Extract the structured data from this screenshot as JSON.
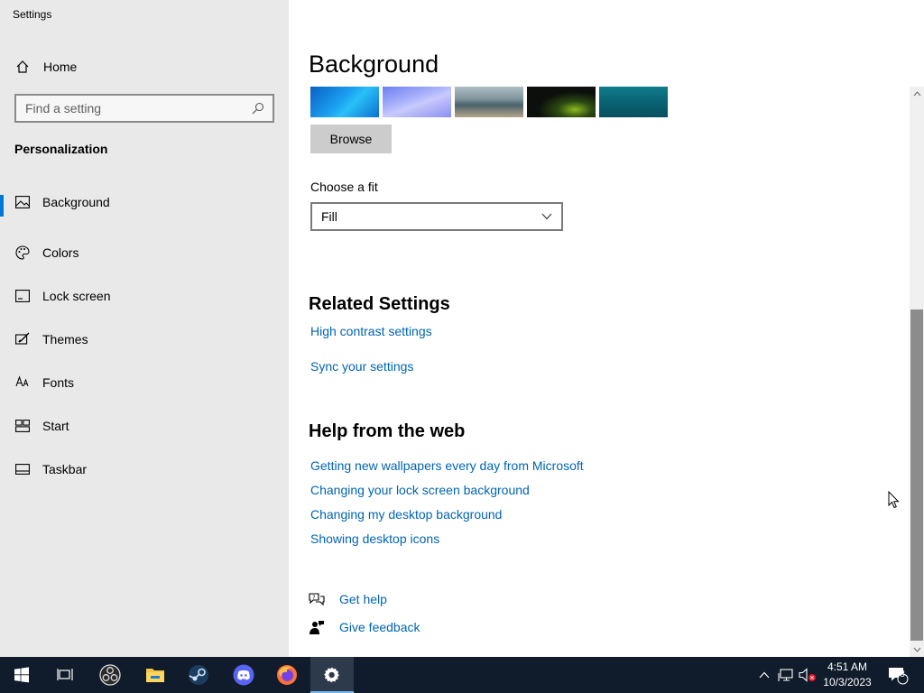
{
  "window": {
    "title": "Settings"
  },
  "sidebar": {
    "home_label": "Home",
    "search_placeholder": "Find a setting",
    "section_title": "Personalization",
    "items": [
      {
        "label": "Background",
        "icon": "picture-icon",
        "active": true
      },
      {
        "label": "Colors",
        "icon": "palette-icon",
        "active": false
      },
      {
        "label": "Lock screen",
        "icon": "lock-screen-icon",
        "active": false
      },
      {
        "label": "Themes",
        "icon": "themes-icon",
        "active": false
      },
      {
        "label": "Fonts",
        "icon": "fonts-icon",
        "active": false
      },
      {
        "label": "Start",
        "icon": "start-icon",
        "active": false
      },
      {
        "label": "Taskbar",
        "icon": "taskbar-icon",
        "active": false
      }
    ]
  },
  "main": {
    "title": "Background",
    "browse_label": "Browse",
    "fit_label": "Choose a fit",
    "fit_value": "Fill",
    "related_title": "Related Settings",
    "related_links": [
      "High contrast settings",
      "Sync your settings"
    ],
    "help_title": "Help from the web",
    "help_links": [
      "Getting new wallpapers every day from Microsoft",
      "Changing your lock screen background",
      "Changing my desktop background",
      "Showing desktop icons"
    ],
    "get_help_label": "Get help",
    "feedback_label": "Give feedback"
  },
  "taskbar": {
    "apps": [
      "start-icon",
      "task-view-icon",
      "obs-icon",
      "file-explorer-icon",
      "steam-icon",
      "discord-icon",
      "firefox-icon",
      "settings-icon"
    ],
    "clock_time": "4:51 AM",
    "clock_date": "10/3/2023",
    "notification_count": "3"
  },
  "colors": {
    "accent": "#0078d7",
    "link": "#0064b4",
    "sidebar_bg": "#e9e9e9",
    "taskbar_bg": "#101c2b"
  }
}
